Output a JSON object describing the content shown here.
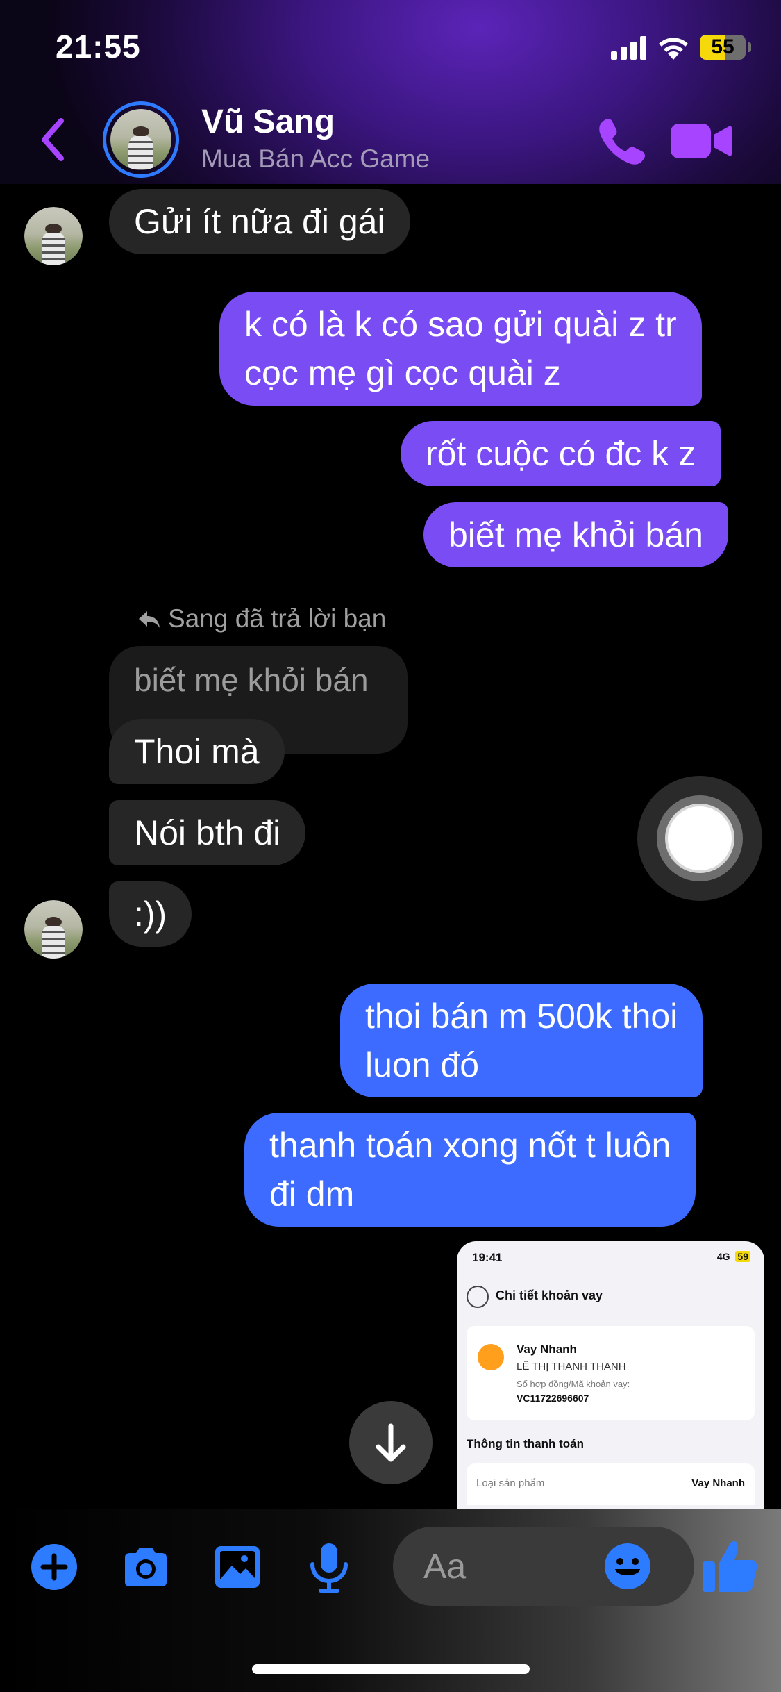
{
  "status_bar": {
    "time": "21:55",
    "battery": "55",
    "battery_level": 0.55
  },
  "header": {
    "contact_name": "Vũ Sang",
    "contact_subtitle": "Mua Bán Acc Game",
    "accent_color": "#a644ff"
  },
  "messages": {
    "m1": "Gửi ít nữa đi gái",
    "m2_line1": "k có là k có sao gửi quài z tr",
    "m2_line2": "cọc mẹ gì cọc quài z",
    "m3": "rốt cuộc có đc k z",
    "m4": "biết mẹ khỏi bán",
    "reply_label": "Sang đã trả lời bạn",
    "quoted": "biết mẹ khỏi bán",
    "m5": "Thoi mà",
    "m6": "Nói bth đi",
    "m7": ":))",
    "m8_line1": "thoi bán m 500k thoi",
    "m8_line2": "luon đó",
    "m9_line1": "thanh toán xong nốt t luôn",
    "m9_line2": "đi dm"
  },
  "shared_image": {
    "time": "19:41",
    "network": "4G",
    "battery": "59",
    "title": "Chi tiết khoản vay",
    "loan_name": "Vay Nhanh",
    "person": "LÊ THỊ THANH THANH",
    "contract_label": "Số hợp đồng/Mã khoản vay:",
    "contract_no": "VC11722696607",
    "section": "Thông tin thanh toán",
    "row_label": "Loại sản phẩm",
    "row_value": "Vay Nhanh"
  },
  "composer": {
    "placeholder": "Aa",
    "accent_color": "#2d7bff"
  }
}
